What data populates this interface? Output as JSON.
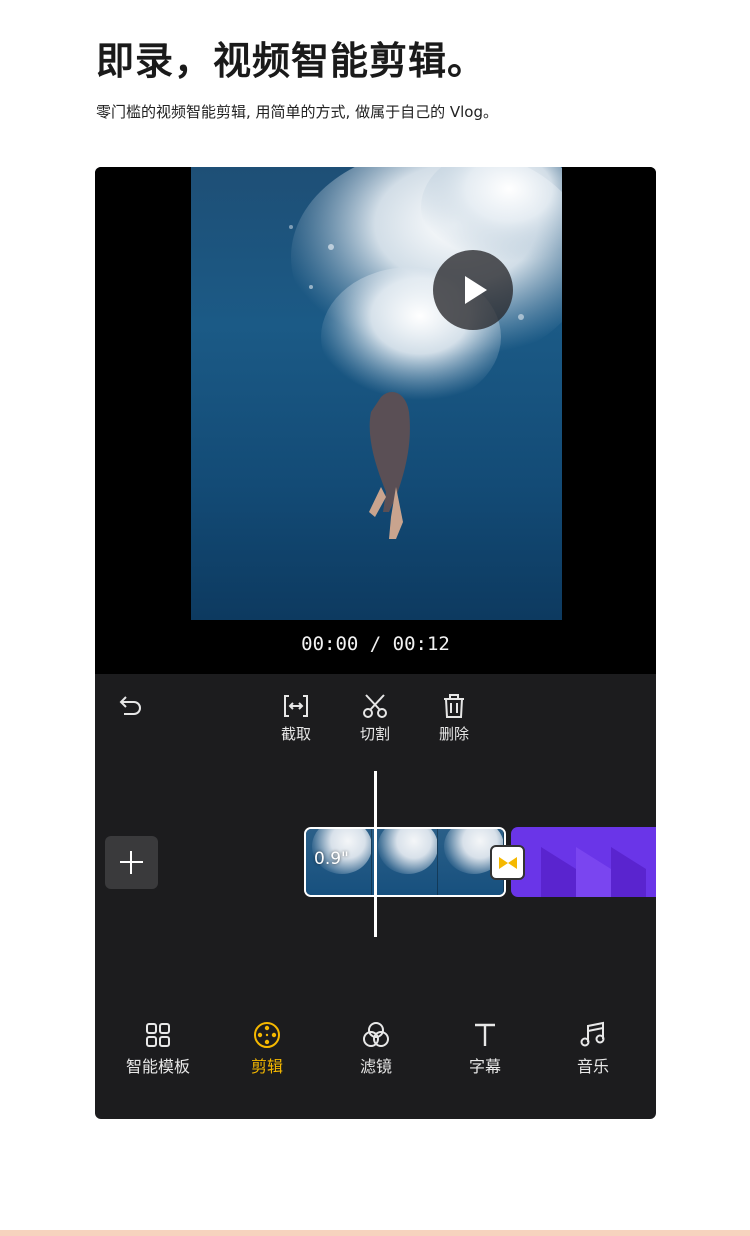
{
  "headline": "即录，视频智能剪辑。",
  "subline": "零门槛的视频智能剪辑, 用简单的方式, 做属于自己的 Vlog。",
  "preview": {
    "play_icon": "play-icon",
    "timecode": "00:00 / 00:12"
  },
  "tools": [
    {
      "label": "截取",
      "icon": "trim-icon"
    },
    {
      "label": "切割",
      "icon": "scissors-icon"
    },
    {
      "label": "删除",
      "icon": "trash-icon"
    }
  ],
  "undo_icon": "undo-icon",
  "timeline": {
    "add_icon": "plus-icon",
    "clip_duration": "0.9\"",
    "transition_icon": "transition-icon",
    "playhead": "playhead"
  },
  "nav": [
    {
      "label": "智能模板",
      "icon": "grid-icon",
      "active": false
    },
    {
      "label": "剪辑",
      "icon": "film-reel-icon",
      "active": true
    },
    {
      "label": "滤镜",
      "icon": "filter-circles-icon",
      "active": false
    },
    {
      "label": "字幕",
      "icon": "text-icon",
      "active": false
    },
    {
      "label": "音乐",
      "icon": "music-note-icon",
      "active": false
    }
  ],
  "colors": {
    "accent": "#f5b800",
    "panel": "#1c1c1e",
    "clip_purple": "#6a35e8"
  }
}
